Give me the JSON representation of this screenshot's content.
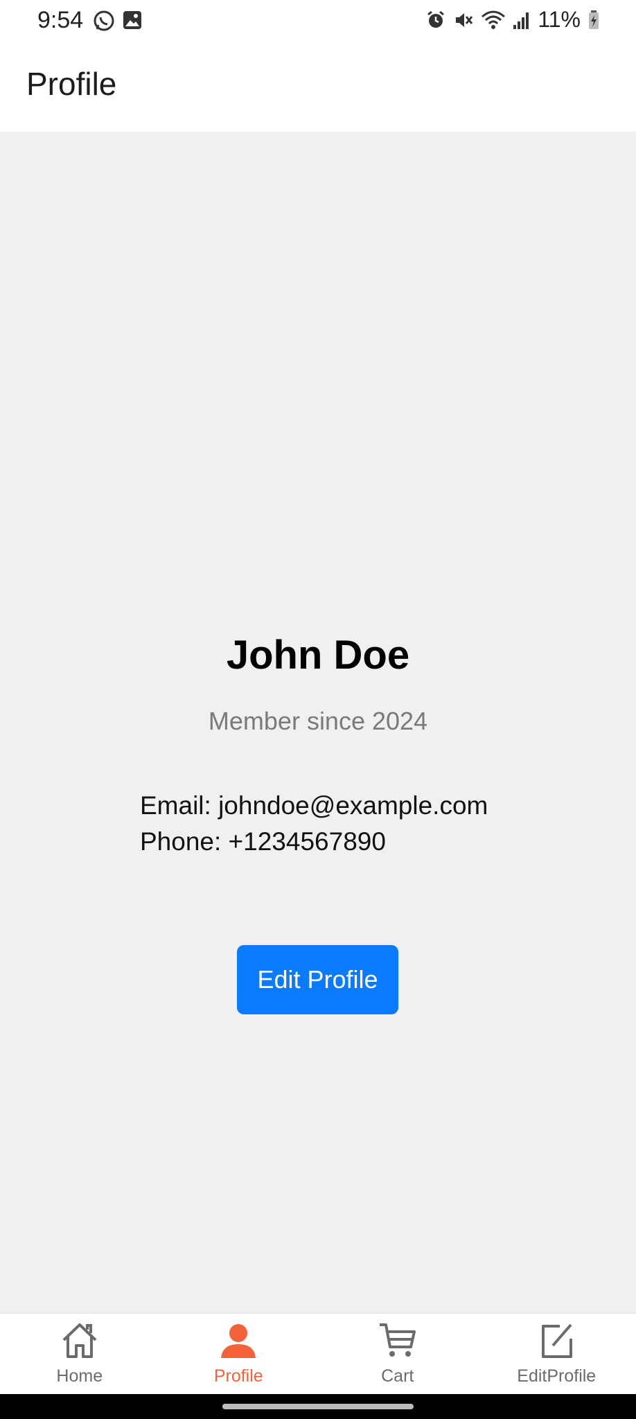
{
  "status_bar": {
    "time": "9:54",
    "battery": "11%",
    "left_icons": [
      "whatsapp-icon",
      "gallery-icon"
    ],
    "right_icons": [
      "alarm-icon",
      "mute-icon",
      "wifi-icon",
      "signal-icon",
      "battery-charging-icon"
    ]
  },
  "header": {
    "title": "Profile"
  },
  "profile": {
    "name": "John Doe",
    "member_since": "Member since 2024",
    "email_line": "Email: johndoe@example.com",
    "phone_line": "Phone: +1234567890",
    "edit_button_label": "Edit Profile"
  },
  "colors": {
    "accent_active": "#f4623a",
    "button_blue": "#0a7bff",
    "content_bg": "#f0f0f0"
  },
  "bottom_nav": {
    "items": [
      {
        "label": "Home",
        "icon": "home-icon",
        "active": false
      },
      {
        "label": "Profile",
        "icon": "person-icon",
        "active": true
      },
      {
        "label": "Cart",
        "icon": "cart-icon",
        "active": false
      },
      {
        "label": "EditProfile",
        "icon": "edit-icon",
        "active": false
      }
    ]
  }
}
